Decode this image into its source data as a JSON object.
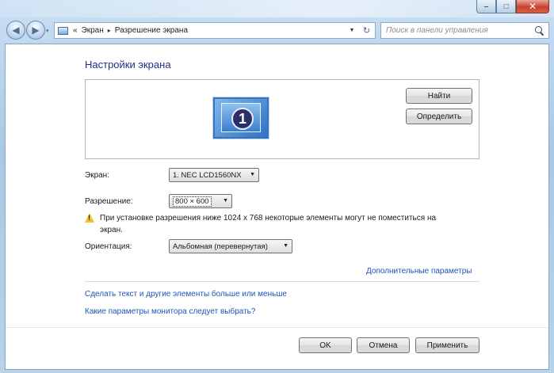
{
  "window": {
    "minimize_glyph": "–",
    "maximize_glyph": "□",
    "close_glyph": "✕"
  },
  "navbar": {
    "back_glyph": "◀",
    "forward_glyph": "▶",
    "history_glyph": "▾",
    "breadcrumb": {
      "prefix": "«",
      "items": [
        "Экран",
        "Разрешение экрана"
      ],
      "separator": "▸"
    },
    "address_dropdown_glyph": "▼",
    "refresh_glyph": "↻",
    "search_placeholder": "Поиск в панели управления"
  },
  "main": {
    "title": "Настройки экрана",
    "monitor_number": "1",
    "find_button": "Найти",
    "identify_button": "Определить",
    "screen_label": "Экран:",
    "screen_value": "1. NEC LCD1560NX",
    "resolution_label": "Разрешение:",
    "resolution_value": "800 × 600",
    "warning_text": "При установке разрешения ниже 1024 х 768 некоторые элементы могут не поместиться на экран.",
    "orientation_label": "Ориентация:",
    "orientation_value": "Альбомная (перевернутая)",
    "advanced_link": "Дополнительные параметры",
    "text_size_link": "Сделать текст и другие элементы больше или меньше",
    "monitor_help_link": "Какие параметры монитора следует выбрать?",
    "dropdown_glyph": "▼"
  },
  "footer": {
    "ok_button": "OK",
    "cancel_button": "Отмена",
    "apply_button": "Применить"
  }
}
